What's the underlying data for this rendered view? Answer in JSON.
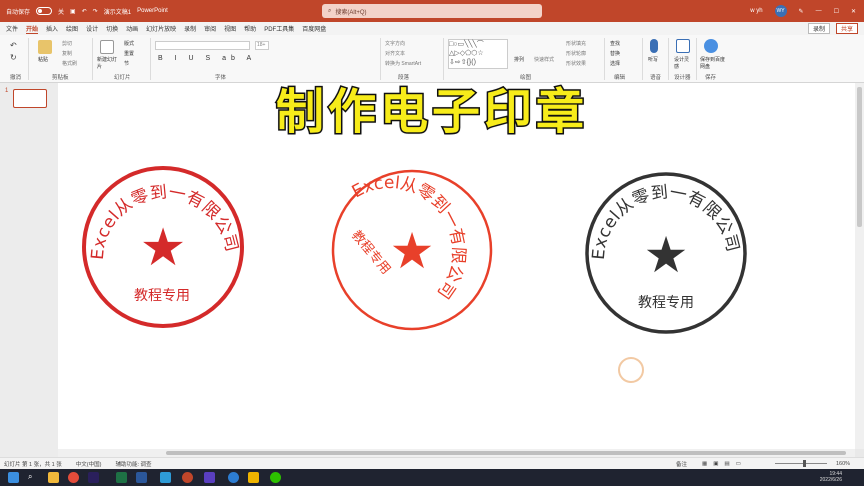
{
  "titlebar": {
    "autosave": "自动保存",
    "autosave_state": "关",
    "doc_title": "演示文稿1",
    "app_name": "PowerPoint",
    "search_placeholder": "搜索(Alt+Q)",
    "user_initials": "WY",
    "user_name": "w yh"
  },
  "tabs": [
    "文件",
    "开始",
    "插入",
    "绘图",
    "设计",
    "切换",
    "动画",
    "幻灯片放映",
    "录制",
    "审阅",
    "视图",
    "帮助",
    "PDF工具集",
    "百度网盘"
  ],
  "tabs_right": {
    "record": "录制",
    "share": "共享"
  },
  "ribbon": {
    "groups": [
      "撤消",
      "剪贴板",
      "幻灯片",
      "字体",
      "段落",
      "绘图",
      "编辑",
      "语音",
      "设计器",
      "保存"
    ],
    "paste": "粘贴",
    "clipboard_items": [
      "剪切",
      "复制",
      "格式刷"
    ],
    "new_slide": "新建幻灯片",
    "slide_items": [
      "版式",
      "重置",
      "节"
    ],
    "font_size": "18+",
    "text_direction": "文字方向",
    "align_text": "对齐文本",
    "convert_smartart": "转换为 SmartArt",
    "arrange": "排列",
    "quick_styles": "快速样式",
    "shape_fill": "形状填充",
    "shape_outline": "形状轮廓",
    "shape_effects": "形状效果",
    "find": "查找",
    "replace": "替换",
    "select": "选择",
    "dictate": "听写",
    "designer": "设计灵感",
    "save_baidu": "保存到百度网盘"
  },
  "slide": {
    "number": "1",
    "title": "制作电子印章",
    "stamps": [
      {
        "arc_text": "Excel从零到一有限公司",
        "bottom_text": "教程专用",
        "color": "#d42a2a"
      },
      {
        "arc_text": "Excel从零到一有限公司",
        "bottom_text": "教程专用",
        "color": "#e8402a"
      },
      {
        "arc_text": "Excel从零到一有限公司",
        "bottom_text": "教程专用",
        "color": "#333333"
      }
    ]
  },
  "statusbar": {
    "slide_count": "幻灯片 第 1 张，共 1 张",
    "language": "中文(中国)",
    "accessibility": "辅助功能: 调查",
    "notes": "备注",
    "zoom": "160%"
  },
  "taskbar": {
    "time": "19:44",
    "date": "2022/6/26"
  }
}
